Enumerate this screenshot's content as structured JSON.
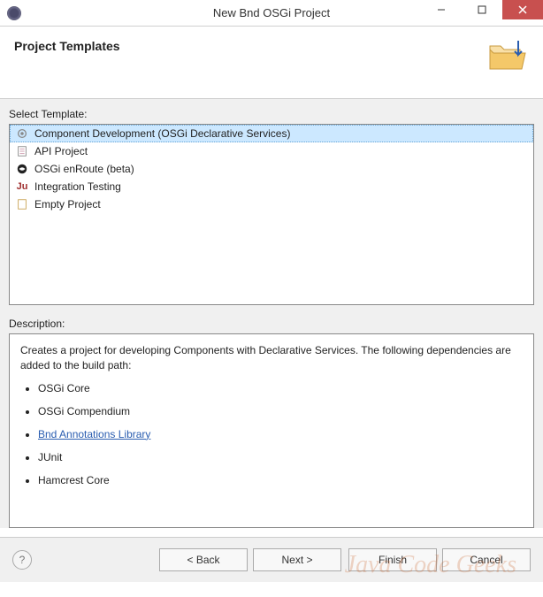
{
  "titlebar": {
    "title": "New Bnd OSGi Project"
  },
  "header": {
    "title": "Project Templates"
  },
  "templates": {
    "label": "Select Template:",
    "items": [
      {
        "label": "Component Development (OSGi Declarative Services)",
        "icon": "gear",
        "selected": true
      },
      {
        "label": "API Project",
        "icon": "doc",
        "selected": false
      },
      {
        "label": "OSGi enRoute (beta)",
        "icon": "enroute",
        "selected": false
      },
      {
        "label": "Integration Testing",
        "icon": "ju",
        "selected": false
      },
      {
        "label": "Empty Project",
        "icon": "empty",
        "selected": false
      }
    ]
  },
  "description": {
    "label": "Description:",
    "intro": "Creates a project for developing Components with Declarative Services. The following dependencies are added to the build path:",
    "deps": [
      {
        "text": "OSGi Core",
        "link": false
      },
      {
        "text": "OSGi Compendium",
        "link": false
      },
      {
        "text": "Bnd Annotations Library",
        "link": true
      },
      {
        "text": "JUnit",
        "link": false
      },
      {
        "text": "Hamcrest Core",
        "link": false
      }
    ]
  },
  "buttons": {
    "back": "< Back",
    "next": "Next >",
    "finish": "Finish",
    "cancel": "Cancel"
  },
  "watermark": "Java Code Geeks"
}
